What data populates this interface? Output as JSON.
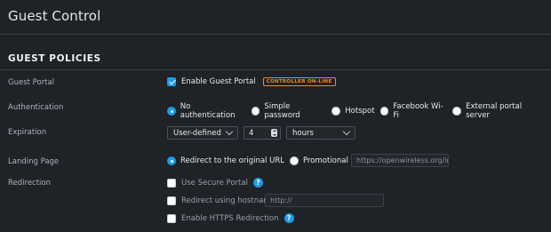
{
  "page": {
    "title": "Guest Control"
  },
  "section": {
    "title": "GUEST POLICIES"
  },
  "guest_portal": {
    "label": "Guest Portal",
    "checkbox_label": "Enable Guest Portal",
    "checked": true,
    "badge": "CONTROLLER ON-LINE"
  },
  "authentication": {
    "label": "Authentication",
    "options": [
      "No authentication",
      "Simple password",
      "Hotspot",
      "Facebook Wi-Fi",
      "External portal server"
    ],
    "selected": "No authentication"
  },
  "expiration": {
    "label": "Expiration",
    "mode": "User-defined",
    "value": "4",
    "unit": "hours"
  },
  "landing_page": {
    "label": "Landing Page",
    "options": [
      "Redirect to the original URL",
      "Promotional URL"
    ],
    "selected": "Redirect to the original URL",
    "url_placeholder": "https://openwireless.org/im"
  },
  "redirection": {
    "label": "Redirection",
    "secure_portal_label": "Use Secure Portal",
    "hostname_label": "Redirect using hostname",
    "hostname_placeholder": "http://",
    "https_label": "Enable HTTPS Redirection",
    "help_glyph": "?"
  },
  "colors": {
    "accent": "#1a9bea",
    "badge": "#f08a24",
    "background": "#1f2227"
  },
  "icons": [
    "checkbox-icon",
    "radio-icon",
    "chevron-down-icon",
    "help-icon"
  ]
}
